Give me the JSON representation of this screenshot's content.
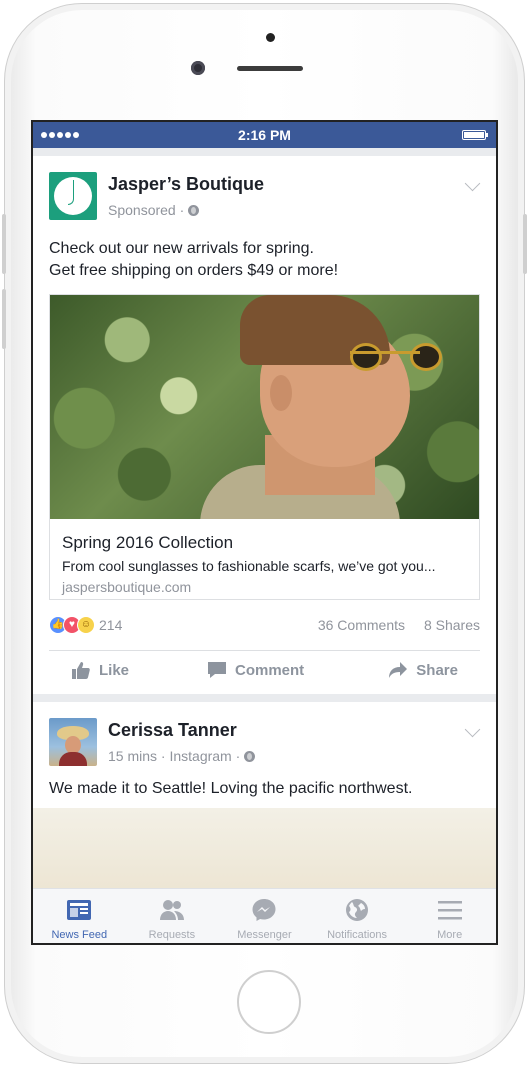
{
  "status": {
    "time": "2:16 PM"
  },
  "post1": {
    "author": "Jasper’s Boutique",
    "meta": "Sponsored ·",
    "text_lines": [
      "Check out our new arrivals for spring.",
      "Get free shipping on orders $49 or more!"
    ],
    "card": {
      "title": "Spring 2016 Collection",
      "description": "From cool sunglasses to fashionable scarfs, we’ve got you...",
      "domain": "jaspersboutique.com"
    },
    "reaction_count": "214",
    "comments": "36 Comments",
    "shares": "8 Shares",
    "actions": {
      "like": "Like",
      "comment": "Comment",
      "share": "Share"
    }
  },
  "post2": {
    "author": "Cerissa Tanner",
    "meta": "15 mins · Instagram ·",
    "text": "We made it to Seattle! Loving the pacific northwest."
  },
  "tabbar": {
    "tabs": [
      {
        "label": "News Feed",
        "icon": "news-feed-icon",
        "active": true
      },
      {
        "label": "Requests",
        "icon": "friend-requests-icon",
        "active": false
      },
      {
        "label": "Messenger",
        "icon": "messenger-icon",
        "active": false
      },
      {
        "label": "Notifications",
        "icon": "globe-icon",
        "active": false
      },
      {
        "label": "More",
        "icon": "menu-icon",
        "active": false
      }
    ]
  },
  "colors": {
    "brand": "#3b5998",
    "active_tab": "#4267b2",
    "muted": "#90949c"
  }
}
